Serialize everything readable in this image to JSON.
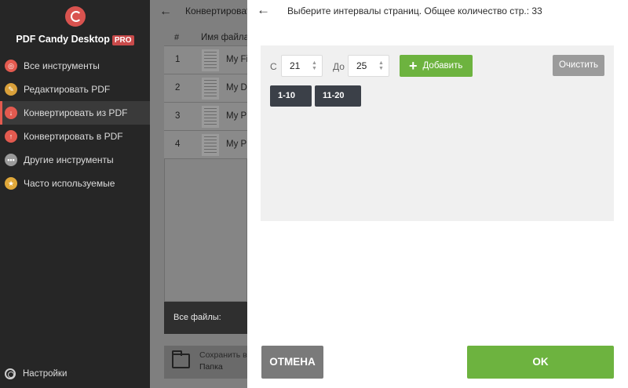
{
  "sidebar": {
    "brand": "PDF Candy Desktop",
    "badge": "PRO",
    "items": [
      {
        "label": "Все инструменты",
        "icon": "all-tools-icon",
        "color": "#e35a4f"
      },
      {
        "label": "Редактировать PDF",
        "icon": "edit-pdf-icon",
        "color": "#d9a03a"
      },
      {
        "label": "Конвертировать из PDF",
        "icon": "convert-from-pdf-icon",
        "color": "#e35a4f"
      },
      {
        "label": "Конвертировать в PDF",
        "icon": "convert-to-pdf-icon",
        "color": "#e35a4f"
      },
      {
        "label": "Другие инструменты",
        "icon": "more-tools-icon",
        "color": "#9a9a9a"
      },
      {
        "label": "Часто используемые",
        "icon": "star-icon",
        "color": "#e0a83a"
      }
    ],
    "active_index": 2,
    "settings": "Настройки"
  },
  "background": {
    "header": "Конвертировать",
    "col_hash": "#",
    "col_name": "Имя файла",
    "rows": [
      {
        "num": "1",
        "name": "My Fi"
      },
      {
        "num": "2",
        "name": "My D"
      },
      {
        "num": "3",
        "name": "My Pl"
      },
      {
        "num": "4",
        "name": "My Pl"
      }
    ],
    "all_files": "Все файлы:",
    "save_label": "Сохранить в",
    "save_folder": "Папка"
  },
  "dialog": {
    "title": "Выберите интервалы страниц. Общее количество стр.: 33",
    "from_label": "С",
    "from_value": "21",
    "to_label": "До",
    "to_value": "25",
    "add_label": "Добавить",
    "clear_label": "Очистить",
    "ranges": [
      "1-10",
      "11-20"
    ],
    "cancel_label": "ОТМЕНА",
    "ok_label": "OK"
  },
  "colors": {
    "accent_green": "#6db33f",
    "accent_red": "#e35a4f",
    "chip": "#3b4048"
  }
}
